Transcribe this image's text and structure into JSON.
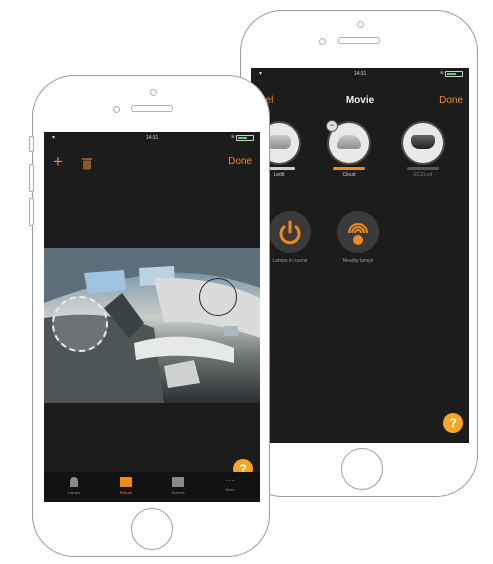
{
  "back_screen": {
    "status": {
      "time": "14:31"
    },
    "nav": {
      "cancel_label": "ncel",
      "title": "Movie",
      "done_label": "Done"
    },
    "scenes": [
      {
        "label": "Ledit",
        "bar": "white"
      },
      {
        "label": "Cloud",
        "bar": "orange"
      },
      {
        "label": "ECZLed",
        "bar": "grey"
      }
    ],
    "actions": [
      {
        "label": "Lamps in scene",
        "icon": "power-icon"
      },
      {
        "label": "Nearby lamps",
        "icon": "nearby-icon"
      }
    ],
    "help_label": "?"
  },
  "front_screen": {
    "status": {
      "time": "14:31"
    },
    "toolbar": {
      "add_label": "+",
      "done_label": "Done"
    },
    "help_label": "?",
    "tabs": [
      {
        "label": "Lamps",
        "active": false
      },
      {
        "label": "Picture",
        "active": true
      },
      {
        "label": "Scenes",
        "active": false
      },
      {
        "label": "More",
        "active": false
      }
    ]
  },
  "colors": {
    "accent": "#f08a1c",
    "help": "#f5a623",
    "screen_bg": "#1c1c1c"
  }
}
